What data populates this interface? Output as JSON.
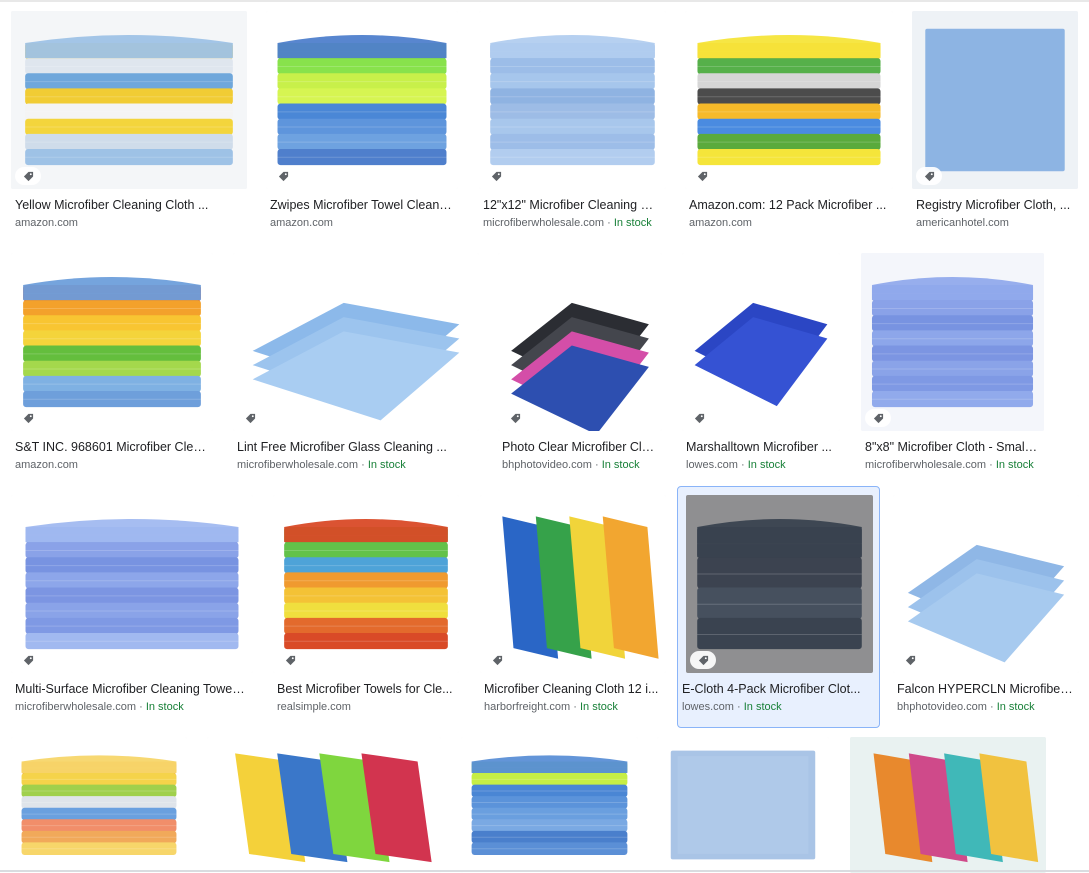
{
  "stock_separator": " · ",
  "results": [
    {
      "title": "Yellow Microfiber Cleaning Cloth ...",
      "source": "amazon.com",
      "stock": ""
    },
    {
      "title": "Zwipes Microfiber Towel Cleani...",
      "source": "amazon.com",
      "stock": ""
    },
    {
      "title": "12\"x12\" Microfiber Cleaning Cl...",
      "source": "microfiberwholesale.com",
      "stock": "In stock"
    },
    {
      "title": "Amazon.com: 12 Pack Microfiber ...",
      "source": "amazon.com",
      "stock": ""
    },
    {
      "title": "Registry Microfiber Cloth, ...",
      "source": "americanhotel.com",
      "stock": ""
    },
    {
      "title": "S&T INC. 968601 Microfiber Clea...",
      "source": "amazon.com",
      "stock": ""
    },
    {
      "title": "Lint Free Microfiber Glass Cleaning ...",
      "source": "microfiberwholesale.com",
      "stock": "In stock"
    },
    {
      "title": "Photo Clear Microfiber Clo...",
      "source": "bhphotovideo.com",
      "stock": "In stock"
    },
    {
      "title": "Marshalltown Microfiber ...",
      "source": "lowes.com",
      "stock": "In stock"
    },
    {
      "title": "8\"x8\" Microfiber Cloth - Small ...",
      "source": "microfiberwholesale.com",
      "stock": "In stock"
    },
    {
      "title": "Multi-Surface Microfiber Cleaning Towel ...",
      "source": "microfiberwholesale.com",
      "stock": "In stock"
    },
    {
      "title": "Best Microfiber Towels for Cle...",
      "source": "realsimple.com",
      "stock": ""
    },
    {
      "title": "Microfiber Cleaning Cloth 12 i...",
      "source": "harborfreight.com",
      "stock": "In stock"
    },
    {
      "title": "E-Cloth 4-Pack Microfiber Clot...",
      "source": "lowes.com",
      "stock": "In stock",
      "selected": true
    },
    {
      "title": "Falcon HYPERCLN Microfiber ...",
      "source": "bhphotovideo.com",
      "stock": "In stock"
    },
    {
      "title": "",
      "source": "",
      "stock": ""
    },
    {
      "title": "",
      "source": "",
      "stock": ""
    },
    {
      "title": "",
      "source": "",
      "stock": ""
    },
    {
      "title": "",
      "source": "",
      "stock": ""
    },
    {
      "title": "",
      "source": "",
      "stock": ""
    }
  ],
  "images": [
    {
      "bg": "#f4f6f8",
      "colors": [
        "#f6d33a",
        "#dfe6ee",
        "#6fa7db",
        "#f1cc34",
        "#f4f4f4",
        "#f3d53c",
        "#cfdcea",
        "#9ec2e6"
      ],
      "style": "stack"
    },
    {
      "bg": "#ffffff",
      "colors": [
        "#6fd43c",
        "#88e24c",
        "#c8f04a",
        "#d6f552",
        "#4a87d6",
        "#5e95dc",
        "#6ea2e0",
        "#4f7fcc"
      ],
      "style": "stack"
    },
    {
      "bg": "#ffffff",
      "colors": [
        "#8fb4e4",
        "#9cbde8",
        "#a6c6ec",
        "#8fb3e2",
        "#9dbce6",
        "#a8c7ec",
        "#9dbde8",
        "#b2cdef"
      ],
      "style": "stack"
    },
    {
      "bg": "#ffffff",
      "colors": [
        "#f3b32c",
        "#56b04a",
        "#d6d6d6",
        "#4c4c4c",
        "#f6ba2a",
        "#4a8be0",
        "#5aaa3c",
        "#f5e53a"
      ],
      "style": "stack"
    },
    {
      "bg": "#eef2f6",
      "colors": [
        "#8db4e3"
      ],
      "style": "flat"
    },
    {
      "bg": "#ffffff",
      "colors": [
        "#d2402a",
        "#f3a12b",
        "#f8c532",
        "#f4d43b",
        "#64be3d",
        "#a4d84c",
        "#7fb1e3",
        "#6e9fdb"
      ],
      "style": "stack"
    },
    {
      "bg": "#ffffff",
      "colors": [
        "#8cb9ea",
        "#9cc4ee",
        "#a9cdf2"
      ],
      "style": "folded"
    },
    {
      "bg": "#ffffff",
      "colors": [
        "#2b2d33",
        "#44464d",
        "#d44ea8",
        "#2d4fb0"
      ],
      "style": "folded"
    },
    {
      "bg": "#ffffff",
      "colors": [
        "#2b46c4",
        "#3552d3"
      ],
      "style": "folded"
    },
    {
      "bg": "#f4f6fb",
      "colors": [
        "#7d97e3",
        "#8aa2e8",
        "#7893e1",
        "#8da6ea",
        "#7c95e2",
        "#8aa3e8",
        "#7f99e4",
        "#91aaec"
      ],
      "style": "stack"
    },
    {
      "bg": "#ffffff",
      "colors": [
        "#7d97e3",
        "#8aa2e8",
        "#7893e1",
        "#8da6ea",
        "#7c95e2",
        "#8aa3e8",
        "#7f99e4",
        "#a1b9f0"
      ],
      "style": "stack"
    },
    {
      "bg": "#ffffff",
      "colors": [
        "#55b83f",
        "#63c24a",
        "#4ea3d8",
        "#f09a2f",
        "#f4c236",
        "#f0df3e",
        "#e36a2c",
        "#d94a27"
      ],
      "style": "stack"
    },
    {
      "bg": "#ffffff",
      "colors": [
        "#2a66c6",
        "#36a24a",
        "#f1d43a",
        "#f2a630"
      ],
      "style": "fan"
    },
    {
      "bg": "#8f8f91",
      "colors": [
        "#2f3642",
        "#3c4350",
        "#46505e",
        "#3a4350"
      ],
      "style": "stack"
    },
    {
      "bg": "#ffffff",
      "colors": [
        "#8fb7e6",
        "#9cc2ec",
        "#a7caef"
      ],
      "style": "folded"
    },
    {
      "bg": "#ffffff",
      "colors": [
        "#f39b3e",
        "#f5d34a",
        "#a0d04c",
        "#dfe4ea",
        "#6aa0df",
        "#f18e6a",
        "#f1a95a",
        "#f7d66a"
      ],
      "style": "stack"
    },
    {
      "bg": "#ffffff",
      "colors": [
        "#f4d13a",
        "#3a77c9",
        "#7fd63e",
        "#d2344f"
      ],
      "style": "fan"
    },
    {
      "bg": "#ffffff",
      "colors": [
        "#7fd240",
        "#c6ee45",
        "#4a86d4",
        "#5b93da",
        "#6a9fdf",
        "#7aa9e3",
        "#4a7fcc",
        "#5b8fd6"
      ],
      "style": "stack"
    },
    {
      "bg": "#ffffff",
      "colors": [
        "#a9c4e6",
        "#b6cdeb"
      ],
      "style": "flat"
    },
    {
      "bg": "#e9f2f1",
      "colors": [
        "#e8892d",
        "#cf4a8a",
        "#40b8b8",
        "#f1c23f"
      ],
      "style": "fan"
    }
  ]
}
